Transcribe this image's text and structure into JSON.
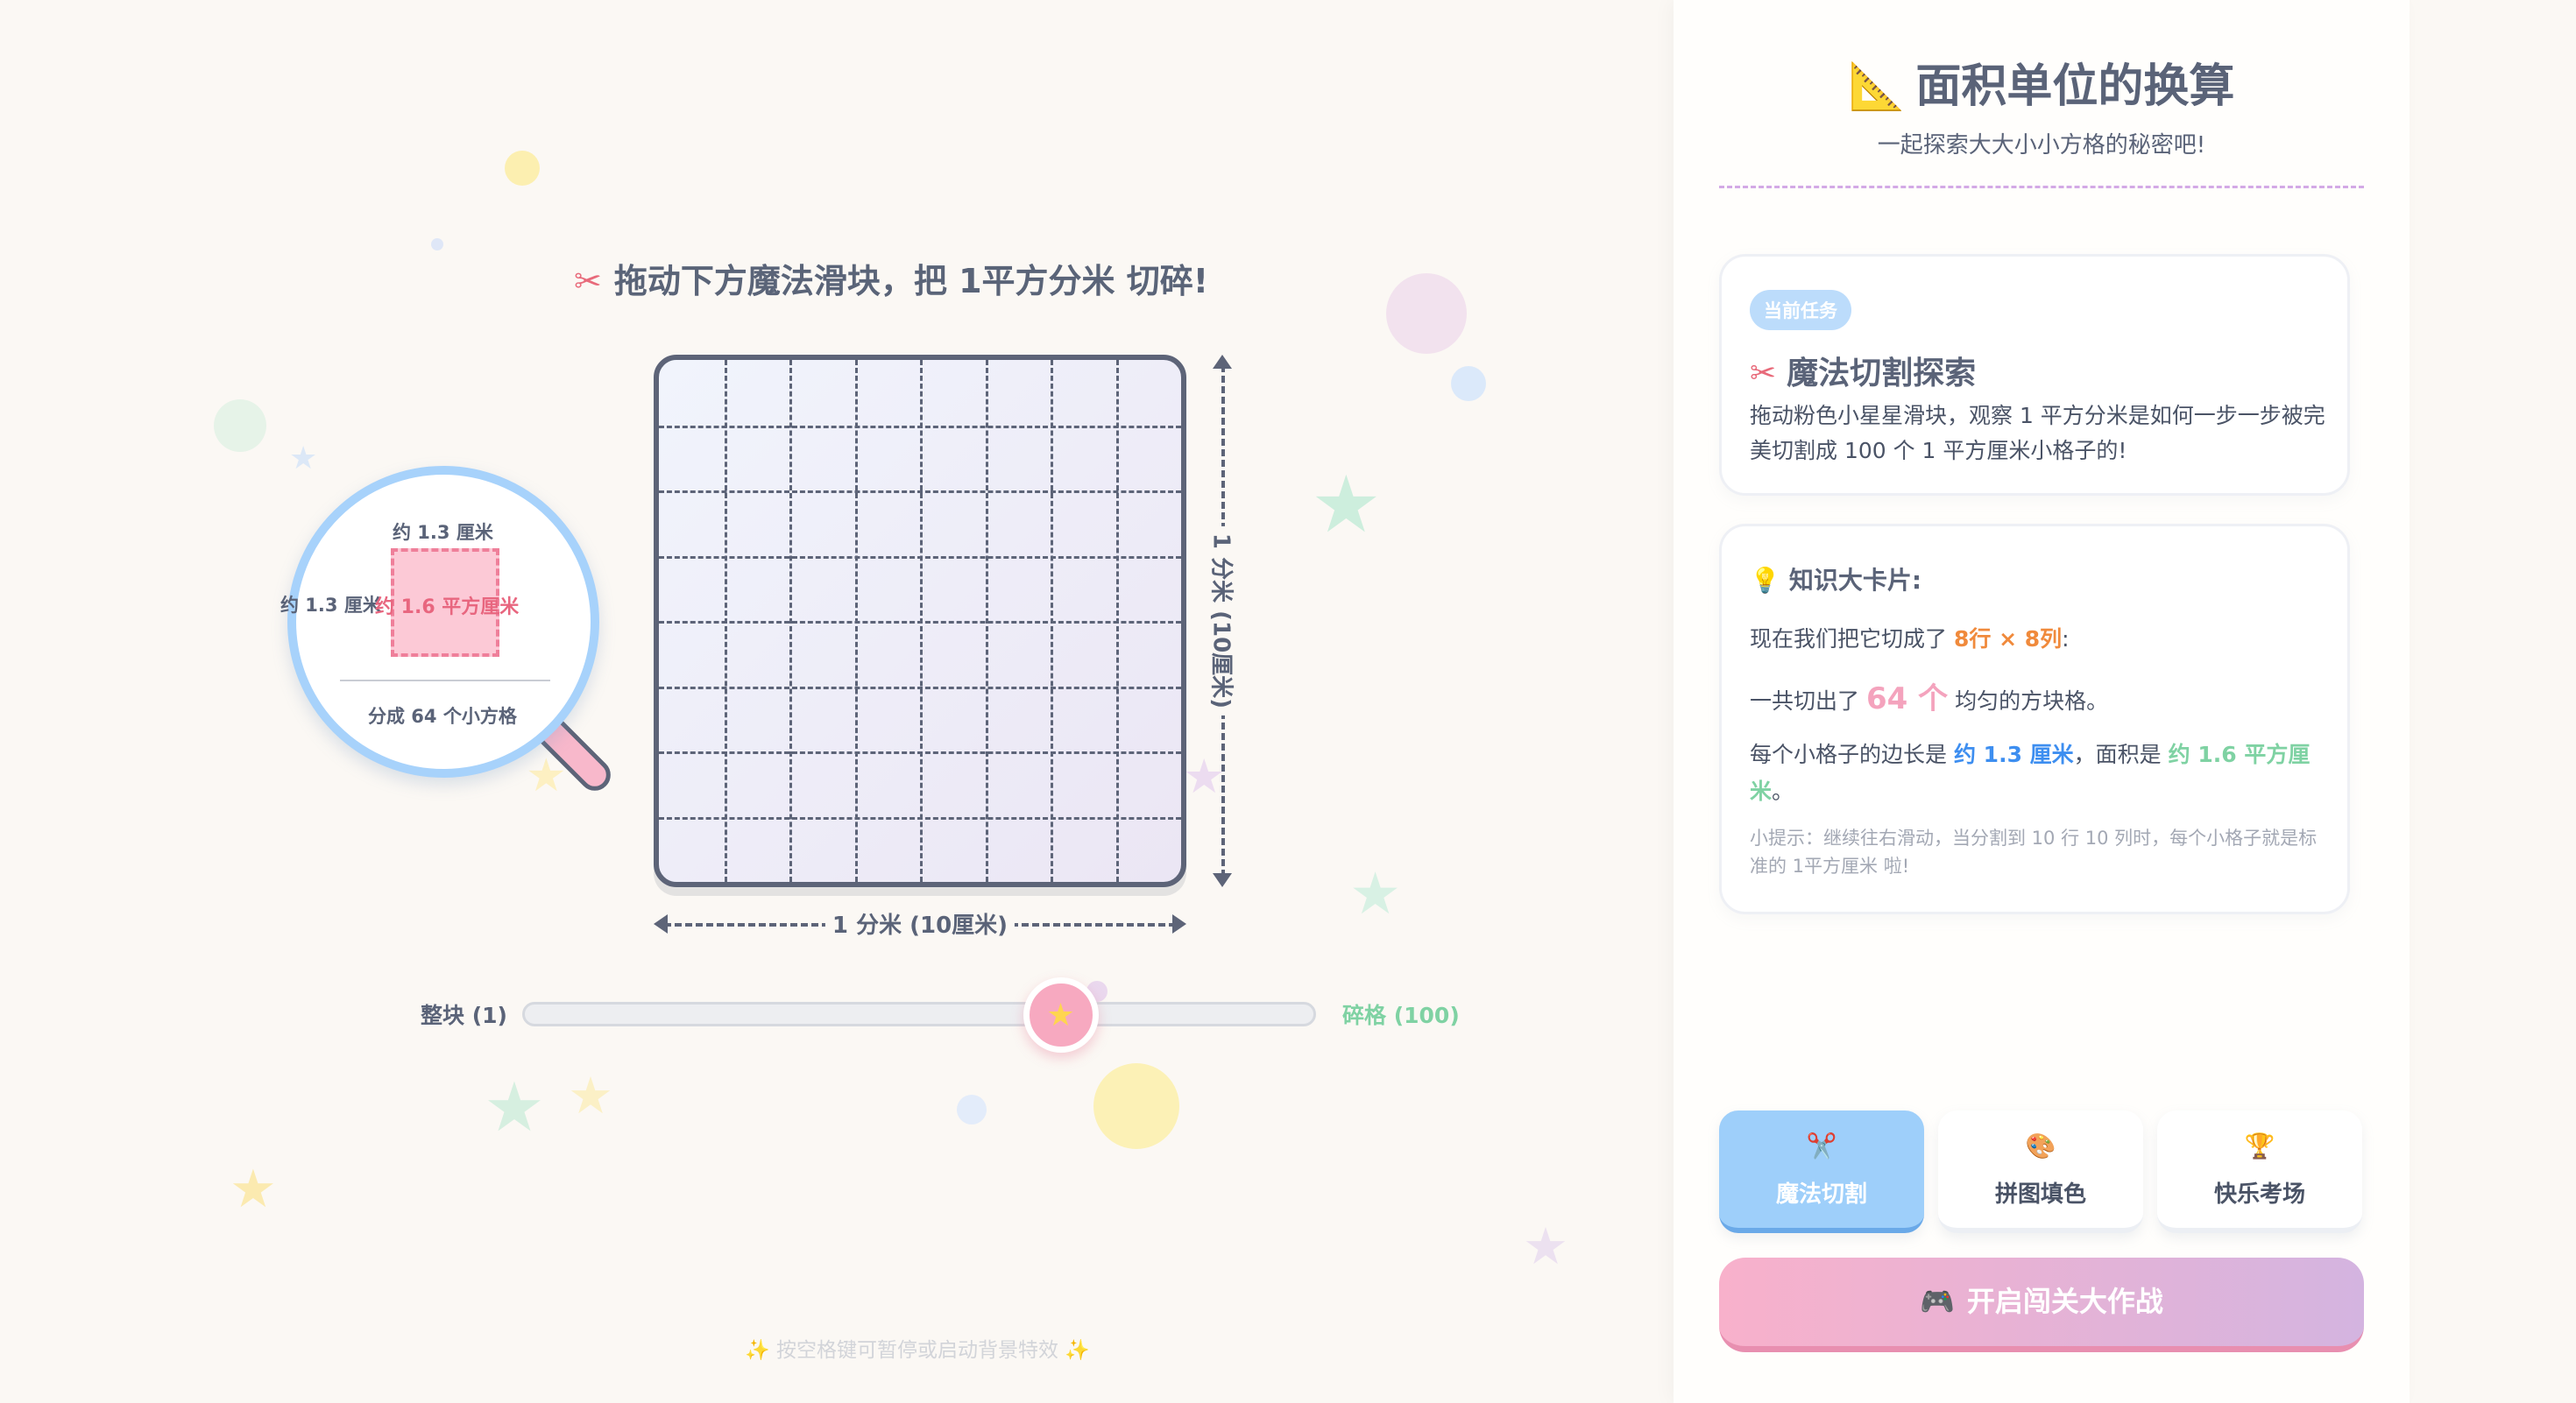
{
  "stage": {
    "instruction": "拖动下方魔法滑块，把 1平方分米 切碎!",
    "instruction_icon": "scissors-icon",
    "grid": {
      "rows": 8,
      "cols": 8
    },
    "dim_horizontal": "1 分米 (10厘米)",
    "dim_vertical": "1 分米 (10厘米)",
    "magnifier": {
      "side_top": "约 1.3 厘米",
      "side_left": "约 1.3 厘米",
      "area": "约 1.6 平方厘米",
      "count": "分成 64 个小方格"
    },
    "slider": {
      "min_label": "整块 (1)",
      "max_label": "碎格 (100)",
      "value": 64,
      "min": 1,
      "max": 100,
      "thumb_icon": "star-icon"
    },
    "footer_hint": "✨ 按空格键可暂停或启动背景特效 ✨"
  },
  "panel": {
    "title": "面积单位的换算",
    "title_icon": "triangle-ruler-icon",
    "subtitle": "一起探索大大小小方格的秘密吧!",
    "task_card": {
      "badge": "当前任务",
      "title": "魔法切割探索",
      "title_icon": "scissors-icon",
      "desc": "拖动粉色小星星滑块，观察 1 平方分米是如何一步一步被完美切割成 100 个 1 平方厘米小格子的!"
    },
    "knowledge_card": {
      "title": "知识大卡片:",
      "title_icon": "lightbulb-icon",
      "line1_prefix": "现在我们把它切成了",
      "line1_value": "8行 × 8列",
      "line1_suffix": ":",
      "line2_prefix": "一共切出了",
      "line2_value": "64 个",
      "line2_suffix": "均匀的方块格。",
      "line3_prefix": "每个小格子的边长是",
      "line3_side": "约 1.3 厘米",
      "line3_mid": "，面积是",
      "line3_area": "约 1.6 平方厘米",
      "line3_suffix": "。",
      "tip": "小提示：继续往右滑动，当分割到 10 行 10 列时，每个小格子就是标准的 1平方厘米 啦!"
    },
    "modes": [
      {
        "label": "魔法切割",
        "icon": "scissors-icon",
        "active": true
      },
      {
        "label": "拼图填色",
        "icon": "palette-icon",
        "active": false
      },
      {
        "label": "快乐考场",
        "icon": "trophy-icon",
        "active": false
      }
    ],
    "start_button": "开启闯关大作战",
    "start_icon": "gamepad-icon"
  },
  "colors": {
    "background": "#fbf8f4",
    "accent_blue": "#9ecffa",
    "accent_pink": "#f7a9c0",
    "accent_green": "#7fd2a3",
    "accent_orange": "#f08a3c",
    "text": "#5a6378"
  }
}
